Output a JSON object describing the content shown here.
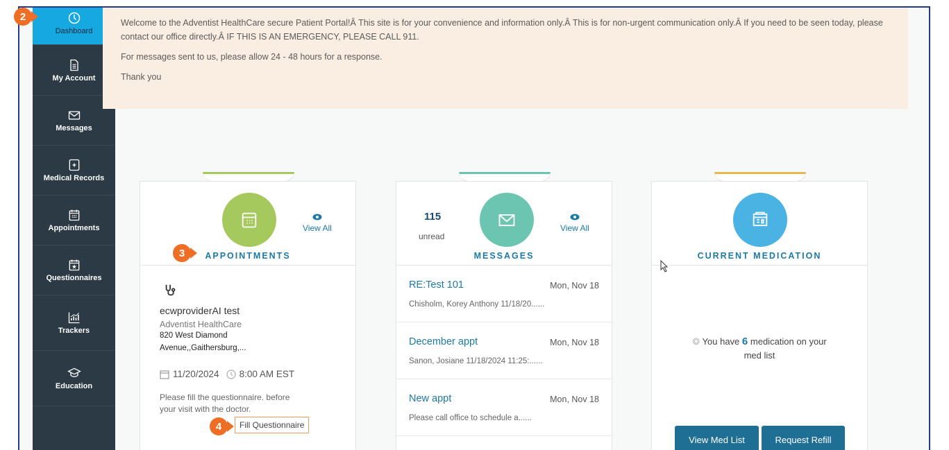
{
  "nav": {
    "items": [
      {
        "label": "Dashboard",
        "icon": "dashboard-icon"
      },
      {
        "label": "My Account",
        "icon": "document-icon"
      },
      {
        "label": "Messages",
        "icon": "envelope-icon"
      },
      {
        "label": "Medical Records",
        "icon": "medical-record-icon"
      },
      {
        "label": "Appointments",
        "icon": "calendar-icon"
      },
      {
        "label": "Questionnaires",
        "icon": "calendar-star-icon"
      },
      {
        "label": "Trackers",
        "icon": "chart-icon"
      },
      {
        "label": "Education",
        "icon": "graduation-cap-icon"
      }
    ]
  },
  "banner": {
    "line1": "Welcome to the Adventist HealthCare secure Patient Portal!Â  This site is for your convenience and information only.Â  This is for non-urgent communication only.Â  If you need to be seen today, please contact our office directly.Â  IF THIS IS AN EMERGENCY, PLEASE CALL 911.",
    "line2": "For messages sent to us, please allow 24 - 48 hours for a response.",
    "line3": "Thank you"
  },
  "callouts": {
    "dashboard": "2",
    "appointments": "3",
    "fill": "4"
  },
  "appointments": {
    "title": "APPOINTMENTS",
    "view_all": "View All",
    "provider": "ecwproviderAI test",
    "org": "Adventist HealthCare",
    "address1": "820 West Diamond",
    "address2": "Avenue,,Gaithersburg,...",
    "date": "11/20/2024",
    "time": "8:00 AM EST",
    "note1": "Please fill the questionnaire. before",
    "note2": "your visit with the doctor.",
    "fill_button": "Fill Questionnaire"
  },
  "messages": {
    "title": "MESSAGES",
    "unread_count": "115",
    "unread_label": "unread",
    "view_all": "View All",
    "items": [
      {
        "subject": "RE:Test 101",
        "date": "Mon, Nov 18",
        "preview": "Chisholm, Korey Anthony 11/18/20......"
      },
      {
        "subject": "December appt",
        "date": "Mon, Nov 18",
        "preview": "Sanon, Josiane 11/18/2024 11:25:......"
      },
      {
        "subject": "New appt",
        "date": "Mon, Nov 18",
        "preview": "Please call office to schedule a......"
      }
    ]
  },
  "medication": {
    "title": "CURRENT MEDICATION",
    "text_before": "You have",
    "count": "6",
    "text_after1": "medication on your",
    "text_after2": "med list",
    "view_button": "View Med List",
    "refill_button": "Request Refill"
  },
  "colors": {
    "sidebar": "#2c3a45",
    "active": "#16a8e0",
    "accent_orange": "#ef6e26",
    "appointments": "#a5c95d",
    "messages": "#6cc5b0",
    "medication": "#4ab3e3",
    "link": "#1b7aa5"
  }
}
